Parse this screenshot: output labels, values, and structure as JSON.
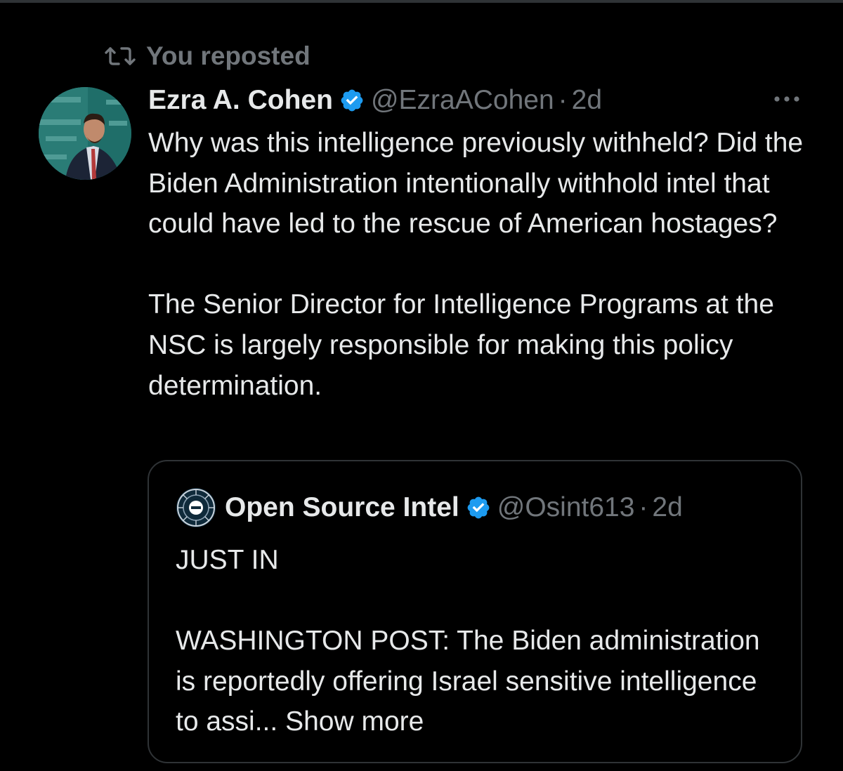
{
  "repost": {
    "label": "You reposted",
    "icon": "repost-icon"
  },
  "tweet": {
    "author_name": "Ezra A. Cohen",
    "handle": "@EzraACohen",
    "separator": "·",
    "time": "2d",
    "verified_color": "#1d9bf0",
    "paragraph_1": "Why was this intelligence previously withheld? Did the Biden Administration intentionally withhold intel that could have led to the rescue of American hostages?",
    "paragraph_2": "The Senior Director for Intelligence Programs at the NSC is largely responsible for making this policy determination."
  },
  "quote": {
    "author_name": "Open Source Intel",
    "handle": "@Osint613",
    "separator": "·",
    "time": "2d",
    "line_1": "JUST IN",
    "paragraph_2": "WASHINGTON POST: The Biden administration is reportedly offering Israel sensitive intelligence to assi...",
    "show_more": "Show more"
  },
  "colors": {
    "background": "#000000",
    "text_primary": "#e7e9ea",
    "text_secondary": "#71767b",
    "border": "#2f3336",
    "verified_blue": "#1d9bf0"
  }
}
